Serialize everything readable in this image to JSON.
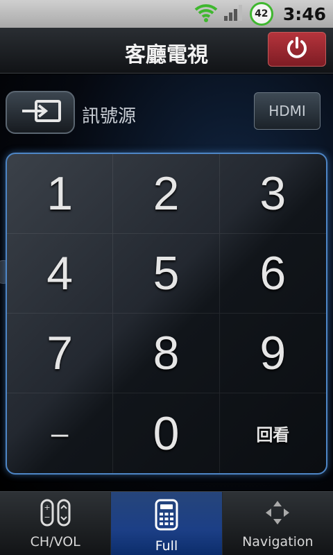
{
  "status_bar": {
    "battery_level": "42",
    "time": "3:46"
  },
  "header": {
    "title": "客廳電視"
  },
  "source": {
    "label": "訊號源",
    "hdmi_label": "HDMI"
  },
  "keypad": {
    "keys": [
      "1",
      "2",
      "3",
      "4",
      "5",
      "6",
      "7",
      "8",
      "9",
      "–",
      "0",
      "回看"
    ]
  },
  "tabs": [
    {
      "label": "CH/VOL",
      "icon": "ch-vol-icon"
    },
    {
      "label": "Full",
      "icon": "remote-keypad-icon",
      "active": true
    },
    {
      "label": "Navigation",
      "icon": "navigation-arrows-icon"
    }
  ],
  "colors": {
    "accent_blue": "#4e86c6",
    "power_red": "#9c2730",
    "battery_green": "#3fb72f"
  }
}
